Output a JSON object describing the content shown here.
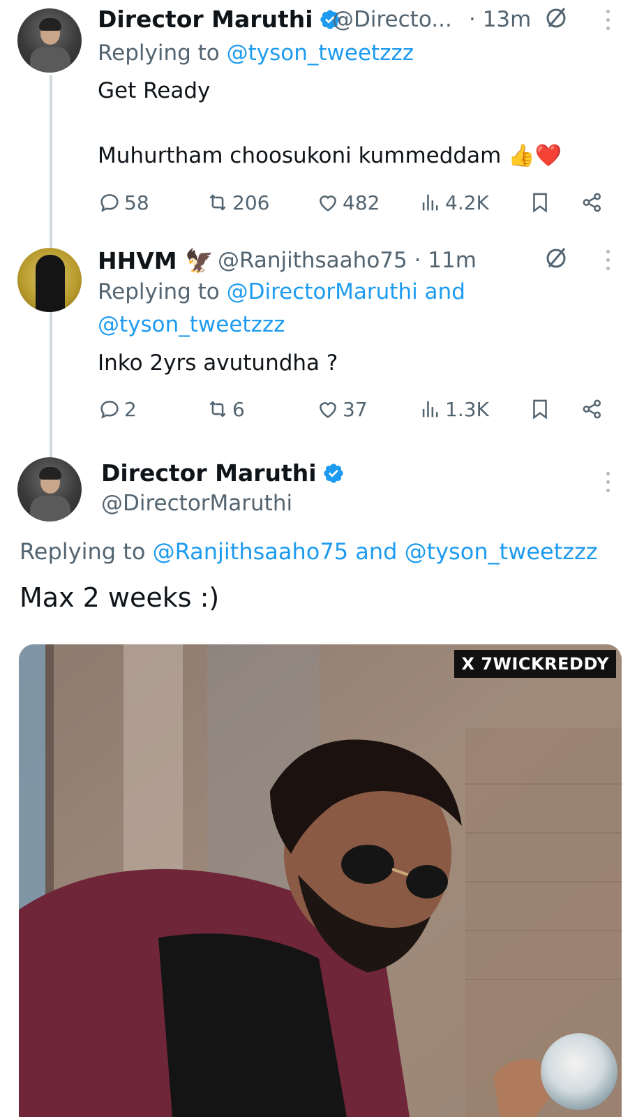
{
  "tweets": [
    {
      "author": "Director Maruthi",
      "handle": "@Directo...",
      "time": "· 13m",
      "replying_prefix": "Replying to ",
      "replying_mentions": "@tyson_tweetzzz",
      "text_line1": "Get Ready",
      "text_line2": "Muhurtham choosukoni kummeddam 👍❤️",
      "stats": {
        "replies": "58",
        "reposts": "206",
        "likes": "482",
        "views": "4.2K"
      }
    },
    {
      "author": "HHVM 🦅",
      "handle": "@Ranjithsaaho75 · 11m",
      "replying_prefix": "Replying to ",
      "replying_mentions_line1": "@DirectorMaruthi and",
      "replying_mentions_line2": "@tyson_tweetzzz",
      "text_line1": "Inko 2yrs avutundha ?",
      "stats": {
        "replies": "2",
        "reposts": "6",
        "likes": "37",
        "views": "1.3K"
      }
    }
  ],
  "main_tweet": {
    "author": "Director Maruthi",
    "handle": "@DirectorMaruthi",
    "replying_prefix": "Replying to ",
    "replying_mentions": "@Ranjithsaaho75 and @tyson_tweetzzz",
    "text": "Max  2 weeks :)",
    "media_watermark": "X 7WICKREDDY"
  },
  "colors": {
    "accent": "#1d9bf0",
    "secondary_text": "#536471",
    "verified": "#1d9bf0"
  },
  "icons": [
    "verified-badge-icon",
    "grok-icon",
    "more-icon",
    "reply-icon",
    "repost-icon",
    "like-icon",
    "views-icon",
    "bookmark-icon",
    "share-icon"
  ]
}
